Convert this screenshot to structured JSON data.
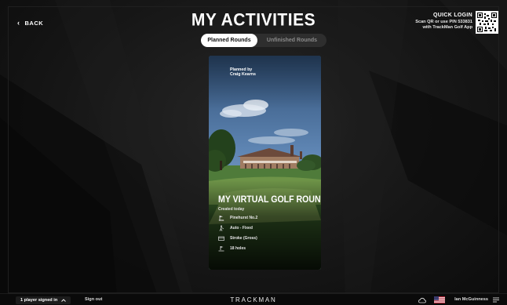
{
  "header": {
    "back_label": "BACK",
    "title": "MY ACTIVITIES",
    "tabs": [
      {
        "label": "Planned Rounds",
        "active": true
      },
      {
        "label": "Unfinished Rounds",
        "active": false
      }
    ],
    "quick_login": {
      "title": "QUICK LOGIN",
      "line1": "Scan QR or use PIN 533831",
      "line2": "with TrackMan Golf App"
    }
  },
  "card": {
    "planned_by_label": "Planned by",
    "planned_by_name": "Craig Kearns",
    "title": "MY VIRTUAL GOLF ROUND",
    "created": "Created today",
    "details": [
      {
        "icon": "course-icon",
        "text": "Pinehurst No.2"
      },
      {
        "icon": "golfer-icon",
        "text": "Auto - Fixed"
      },
      {
        "icon": "scorecard-icon",
        "text": "Stroke (Gross)"
      },
      {
        "icon": "holes-icon",
        "text": "18 holes"
      }
    ]
  },
  "footer": {
    "players_label": "1 player signed in",
    "signout_label": "Sign out",
    "brand": "TRACKMAN",
    "user_name": "Ian McGuinness",
    "cloud_icon": "cloud-icon",
    "flag_icon": "us-flag-icon",
    "menu_icon": "menu-icon"
  },
  "colors": {
    "background": "#141414",
    "tab_active_bg": "#ffffff",
    "tab_track_bg": "#2e2e2e",
    "sky": "#3a5b82"
  }
}
